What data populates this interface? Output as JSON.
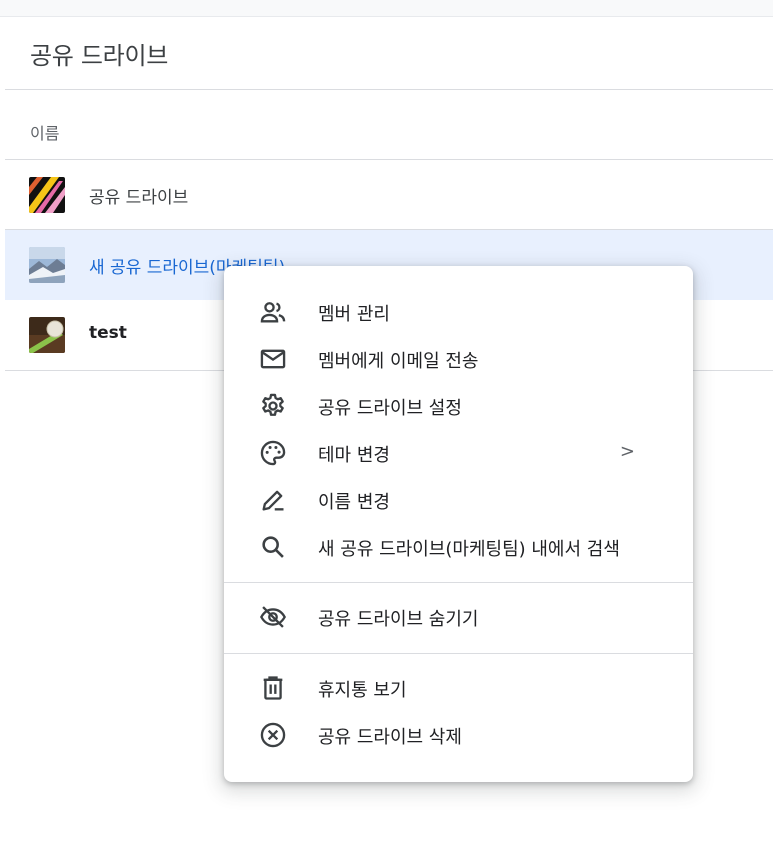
{
  "page": {
    "title": "공유 드라이브",
    "column_name": "이름"
  },
  "drives": [
    {
      "name": "공유 드라이브",
      "thumbnail": "colorful-stripes-thumbnail"
    },
    {
      "name": "새 공유 드라이브(마케팅팀)",
      "thumbnail": "mountain-landscape-thumbnail",
      "selected": true
    },
    {
      "name": "test",
      "thumbnail": "tennis-ball-thumbnail"
    }
  ],
  "context_menu": {
    "items": [
      {
        "label": "멤버 관리",
        "icon": "people-icon"
      },
      {
        "label": "멤버에게 이메일 전송",
        "icon": "mail-icon"
      },
      {
        "label": "공유 드라이브 설정",
        "icon": "gear-icon"
      },
      {
        "label": "테마 변경",
        "icon": "palette-icon",
        "submenu": ">"
      },
      {
        "label": "이름 변경",
        "icon": "pencil-icon"
      },
      {
        "label": "새 공유 드라이브(마케팅팀) 내에서 검색",
        "icon": "search-icon"
      },
      {
        "label": "공유 드라이브 숨기기",
        "icon": "eye-off-icon"
      },
      {
        "label": "휴지통 보기",
        "icon": "trash-icon"
      },
      {
        "label": "공유 드라이브 삭제",
        "icon": "cancel-circle-icon"
      }
    ]
  },
  "colors": {
    "selected_row_bg": "#e8f0fe",
    "selected_text": "#1967d2",
    "divider": "#dadce0"
  }
}
